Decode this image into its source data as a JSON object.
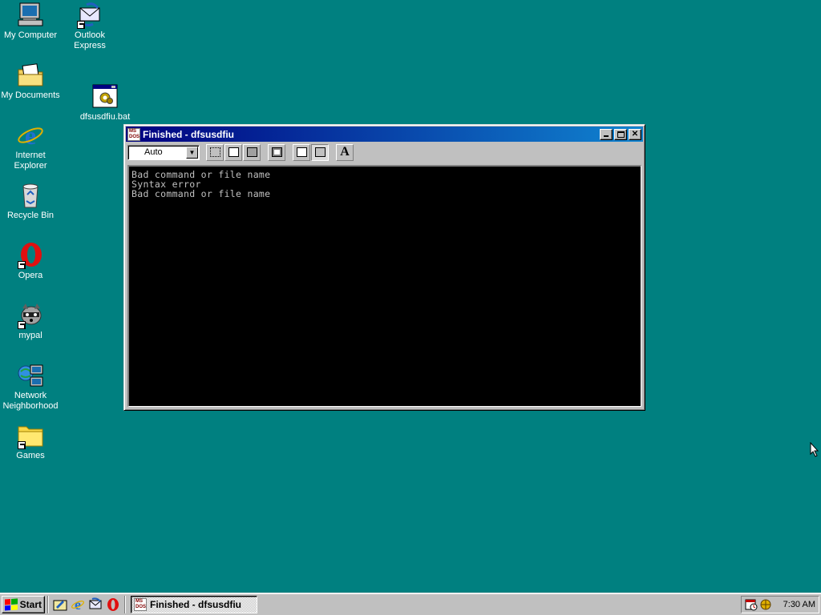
{
  "desktop": {
    "background_color": "#008080",
    "icons": [
      {
        "label": "My Computer",
        "icon": "my-computer-icon"
      },
      {
        "label": "Outlook Express",
        "icon": "outlook-express-icon"
      },
      {
        "label": "My Documents",
        "icon": "my-documents-icon"
      },
      {
        "label": "dfsusdfiu.bat",
        "icon": "batch-file-icon"
      },
      {
        "label": "Internet Explorer",
        "icon": "internet-explorer-icon"
      },
      {
        "label": "Recycle Bin",
        "icon": "recycle-bin-icon"
      },
      {
        "label": "Opera",
        "icon": "opera-icon"
      },
      {
        "label": "mypal",
        "icon": "mypal-icon"
      },
      {
        "label": "Network Neighborhood",
        "icon": "network-neighborhood-icon"
      },
      {
        "label": "Games",
        "icon": "folder-icon"
      }
    ]
  },
  "window": {
    "title": "Finished - dfsusdfiu",
    "app_icon_text": "MS-DOS",
    "toolbar": {
      "font_size_value": "Auto",
      "buttons": [
        "mark",
        "copy",
        "paste",
        "full-screen",
        "properties",
        "background",
        "font"
      ],
      "font_button_label": "A"
    },
    "console": {
      "lines": [
        "Bad command or file name",
        "Syntax error",
        "Bad command or file name"
      ]
    }
  },
  "taskbar": {
    "start_label": "Start",
    "quick_launch": [
      "show-desktop-icon",
      "internet-explorer-icon",
      "outlook-express-icon",
      "opera-icon"
    ],
    "task_label": "Finished - dfsusdfiu",
    "clock": "7:30 AM"
  }
}
